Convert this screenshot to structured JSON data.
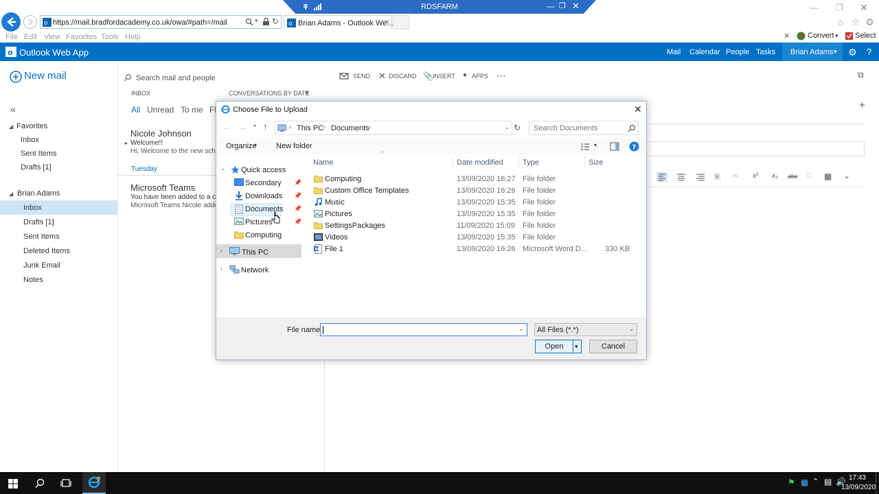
{
  "browser": {
    "rds_title": "RDSFARM",
    "url": "https://mail.bradfordacademy.co.uk/owa/#path=/mail",
    "tab_title": "Brian Adams - Outlook We...",
    "menu": [
      "File",
      "Edit",
      "View",
      "Favorites",
      "Tools",
      "Help"
    ],
    "convert_label": "Convert",
    "select_label": "Select"
  },
  "owa": {
    "brand": "Outlook Web App",
    "nav": [
      "Mail",
      "Calendar",
      "People",
      "Tasks"
    ],
    "user": "Brian Adams",
    "new_mail": "New mail",
    "search_placeholder": "Search mail and people",
    "inbox_label": "INBOX",
    "conversations_label": "CONVERSATIONS BY DATE",
    "filters": [
      "All",
      "Unread",
      "To me",
      "Fl"
    ],
    "compose_actions": [
      "SEND",
      "DISCARD",
      "INSERT",
      "APPS"
    ],
    "favorites": {
      "header": "Favorites",
      "items": [
        "Inbox",
        "Sent Items",
        "Drafts [1]"
      ]
    },
    "account": {
      "header": "Brian Adams",
      "items": [
        "Inbox",
        "Drafts [1]",
        "Sent Items",
        "Deleted Items",
        "Junk Email",
        "Notes"
      ]
    },
    "messages": [
      {
        "sender": "Nicole Johnson",
        "subject": "Welcome!!",
        "preview": "Hi, Welcome to the new scho"
      },
      {
        "group": "Tuesday"
      },
      {
        "sender": "Microsoft Teams",
        "subject": "You have been added to a cla",
        "preview": "Microsoft Teams Nicole adde"
      }
    ]
  },
  "dialog": {
    "title": "Choose File to Upload",
    "breadcrumb": [
      "This PC",
      "Documents"
    ],
    "search_placeholder": "Search Documents",
    "organize": "Organize",
    "new_folder": "New folder",
    "nav_pane": {
      "quick_access": "Quick access",
      "items": [
        "Secondary",
        "Downloads",
        "Documents",
        "Pictures",
        "Computing"
      ],
      "this_pc": "This PC",
      "network": "Network"
    },
    "columns": [
      "Name",
      "Date modified",
      "Type",
      "Size"
    ],
    "files": [
      {
        "name": "Computing",
        "date": "13/09/2020 16:27",
        "type": "File folder",
        "size": "",
        "icon": "folder-icon"
      },
      {
        "name": "Custom Office Templates",
        "date": "13/09/2020 16:26",
        "type": "File folder",
        "size": "",
        "icon": "folder-icon"
      },
      {
        "name": "Music",
        "date": "13/09/2020 15:35",
        "type": "File folder",
        "size": "",
        "icon": "music-folder-icon"
      },
      {
        "name": "Pictures",
        "date": "13/09/2020 15:35",
        "type": "File folder",
        "size": "",
        "icon": "pictures-folder-icon"
      },
      {
        "name": "SettingsPackages",
        "date": "11/09/2020 15:09",
        "type": "File folder",
        "size": "",
        "icon": "folder-icon"
      },
      {
        "name": "Videos",
        "date": "13/09/2020 15:35",
        "type": "File folder",
        "size": "",
        "icon": "videos-folder-icon"
      },
      {
        "name": "File 1",
        "date": "13/09/2020 16:26",
        "type": "Microsoft Word D...",
        "size": "330 KB",
        "icon": "word-doc-icon"
      }
    ],
    "file_name_label": "File name:",
    "file_name_value": "",
    "file_type": "All Files (*.*)",
    "open": "Open",
    "cancel": "Cancel"
  },
  "taskbar": {
    "time": "17:43",
    "date": "13/09/2020"
  },
  "colors": {
    "owa_blue": "#0072c6",
    "rds_blue": "#2b6cc4",
    "selection": "#cce8ff",
    "taskbar": "#101010"
  }
}
